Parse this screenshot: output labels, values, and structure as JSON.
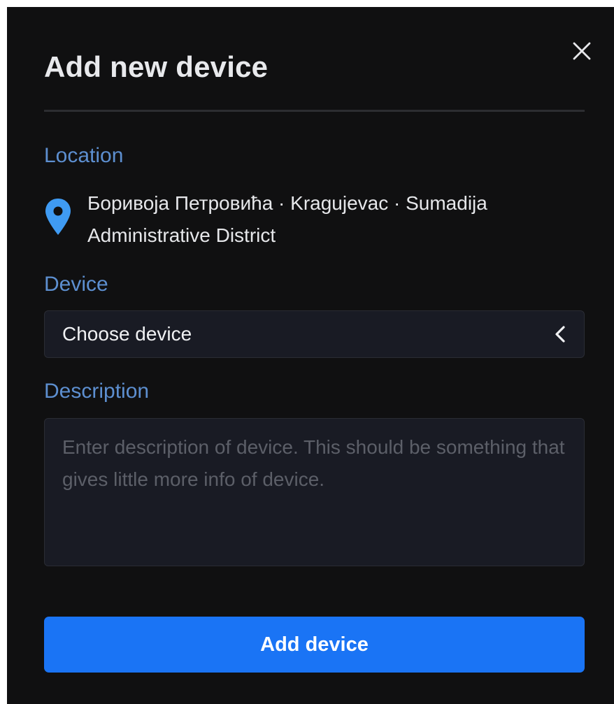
{
  "modal": {
    "title": "Add new device",
    "close_icon": "close-icon"
  },
  "location": {
    "label": "Location",
    "icon": "map-pin-icon",
    "line1": "Боривоја Петровића · Kragujevac · Sumadija",
    "line2": "Administrative District"
  },
  "device": {
    "label": "Device",
    "selected": "Choose device",
    "icon": "chevron-left-icon"
  },
  "description": {
    "label": "Description",
    "placeholder": "Enter description of device. This should be something that gives little more info of device.",
    "value": ""
  },
  "submit": {
    "label": "Add device"
  },
  "colors": {
    "background": "#101011",
    "label": "#5d8fd0",
    "field": "#191b24",
    "accent": "#1a74f5",
    "pin": "#3f9bf3"
  }
}
